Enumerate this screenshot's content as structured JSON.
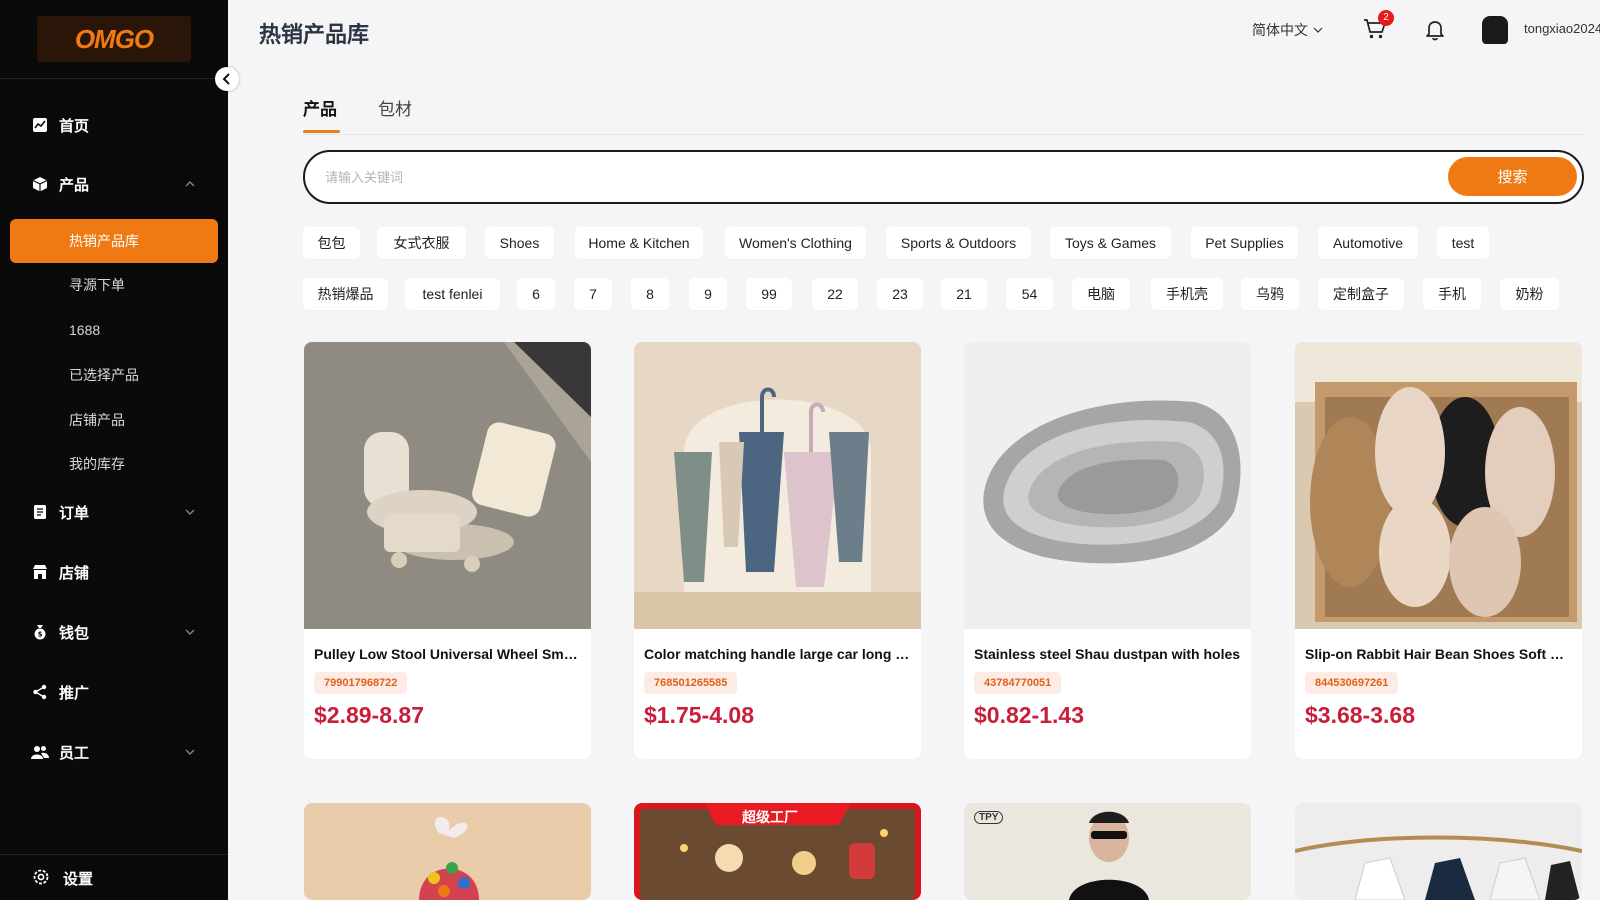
{
  "sidebar": {
    "logo": "OMGO",
    "nav": [
      {
        "label": "首页",
        "icon": "chart-icon"
      },
      {
        "label": "产品",
        "icon": "box-icon"
      },
      {
        "label": "订单",
        "icon": "order-icon"
      },
      {
        "label": "店铺",
        "icon": "store-icon"
      },
      {
        "label": "钱包",
        "icon": "wallet-icon"
      },
      {
        "label": "推广",
        "icon": "share-icon"
      },
      {
        "label": "员工",
        "icon": "staff-icon"
      }
    ],
    "product_sub": [
      "热销产品库",
      "寻源下单",
      "1688",
      "已选择产品",
      "店铺产品",
      "我的库存"
    ],
    "settings": "设置"
  },
  "header": {
    "title": "热销产品库",
    "language": "简体中文",
    "cart_count": "2",
    "username": "tongxiao2024"
  },
  "tabs": [
    "产品",
    "包材"
  ],
  "search": {
    "placeholder": "请输入关键词",
    "button": "搜索"
  },
  "categories": {
    "row1": [
      "包包",
      "女式衣服",
      "Shoes",
      "Home & Kitchen",
      "Women's Clothing",
      "Sports & Outdoors",
      "Toys & Games",
      "Pet Supplies",
      "Automotive",
      "test"
    ],
    "row2": [
      "热销爆品",
      "test fenlei",
      "6",
      "7",
      "8",
      "9",
      "99",
      "22",
      "23",
      "21",
      "54",
      "电脑",
      "手机壳",
      "乌鸦",
      "定制盒子",
      "手机",
      "奶粉"
    ]
  },
  "products": [
    {
      "title": "Pulley Low Stool Universal Wheel Small Stool",
      "id": "799017968722",
      "price": "$2.89-8.87"
    },
    {
      "title": "Color matching handle large car long handle umbrella",
      "id": "768501265585",
      "price": "$1.75-4.08"
    },
    {
      "title": "Stainless steel Shau dustpan with holes",
      "id": "43784770051",
      "price": "$0.82-1.43"
    },
    {
      "title": "Slip-on Rabbit Hair Bean Shoes Soft Sole",
      "id": "844530697261",
      "price": "$3.68-3.68"
    }
  ],
  "second_row": {
    "banner_text": "超级工厂",
    "brand_badge": "TPY"
  },
  "colors": {
    "accent": "#ef7a14",
    "sidebar_bg": "#0a0a0a",
    "price": "#c81e3a",
    "badge": "#e91919"
  }
}
